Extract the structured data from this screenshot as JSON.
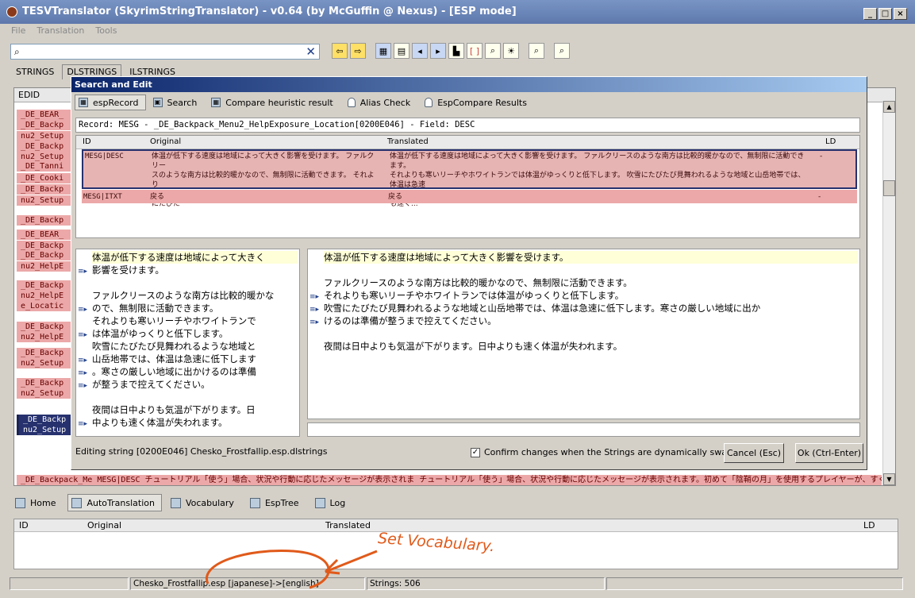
{
  "window": {
    "title": "TESVTranslator (SkyrimStringTranslator) - v0.64 (by McGuffin @ Nexus) - [ESP mode]",
    "buttons": [
      "_",
      "□",
      "×"
    ]
  },
  "menu": [
    "File",
    "Translation",
    "Tools"
  ],
  "search": {
    "value": "",
    "placeholder": ""
  },
  "top_tabs": [
    "STRINGS",
    "DLSTRINGS",
    "ILSTRINGS"
  ],
  "list": {
    "header": "EDID",
    "rows": [
      "_DE_BEAR_",
      "_DE_Backp",
      "nu2_Setup",
      "_DE_Backp",
      "nu2_Setup",
      "_DE_Tanni",
      "_DE_Cooki",
      "_DE_Backp",
      "nu2_Setup",
      "_DE_Backp",
      "_DE_BEAR_",
      "_DE_Backp",
      "_DE_Backp",
      "nu2_HelpE",
      "_DE_Backp",
      "nu2_HelpE",
      "e_Locatic",
      "_DE_Backp",
      "nu2_HelpE",
      "_DE_Backp",
      "nu2_Setup",
      "_DE_Backp",
      "nu2_Setup",
      "_DE_Backp",
      "nu2_Setup"
    ],
    "last_row": "_DE_Backpack_Me    MESG|DESC    チュートリアル「使う」場合、状況や行動に応じたメッセージが表示されま    チュートリアル「使う」場合、状況や行動に応じたメッセージが表示されます。初めて「陰鞘の月」を使用するプレイヤーが、すぐに遊べる"
  },
  "dialog": {
    "title": "Search and Edit",
    "tabs": [
      "espRecord",
      "Search",
      "Compare heuristic result",
      "Alias Check",
      "EspCompare Results"
    ],
    "record": "Record: MESG - _DE_Backpack_Menu2_HelpExposure_Location[0200E046] - Field: DESC",
    "grid": {
      "headers": [
        "ID",
        "Original",
        "Translated",
        "LD"
      ],
      "rows": [
        {
          "id": "MESG|DESC",
          "original": [
            "体温が低下する速度は地域によって大きく影響を受けます。 ファルクリー",
            "スのような南方は比較的暖かなので、無制限に活動できます。 それより",
            "も寒いリーチやホワイトランでは体温がゆっくりと低下します。 吹雪にたびた"
          ],
          "translated": [
            "体温が低下する速度は地域によって大きく影響を受けます。 ファルクリースのような南方は比較的暖かなので、無制限に活動できます。",
            "それよりも寒いリーチやホワイトランでは体温がゆっくりと低下します。 吹雪にたびたび見舞われるような地域と山岳地帯では、体温は急速",
            "に低下します。寒さの厳しい地域に出かけるのは準備が整うまで控えてください。 夜間は日中よりも気温が下がります。日中よりも速く..."
          ],
          "ld": "-"
        },
        {
          "id": "MESG|ITXT",
          "original": [
            "戻る"
          ],
          "translated": [
            "戻る"
          ],
          "ld": "-"
        }
      ]
    },
    "left_lines": [
      "体温が低下する速度は地域によって大きく",
      "影響を受けます。",
      "",
      "ファルクリースのような南方は比較的暖かな",
      "ので、無制限に活動できます。",
      " それよりも寒いリーチやホワイトランで",
      "は体温がゆっくりと低下します。",
      " 吹雪にたびたび見舞われるような地域と",
      "山岳地帯では、体温は急速に低下します",
      "。寒さの厳しい地域に出かけるのは準備",
      "が整うまで控えてください。",
      "",
      "夜間は日中よりも気温が下がります。日",
      "中よりも速く体温が失われます。"
    ],
    "right_lines": [
      "体温が低下する速度は地域によって大きく影響を受けます。",
      "",
      "ファルクリースのような南方は比較的暖かなので、無制限に活動できます。",
      " それよりも寒いリーチやホワイトランでは体温がゆっくりと低下します。",
      " 吹雪にたびたび見舞われるような地域と山岳地帯では、体温は急速に低下します。寒さの厳しい地域に出か",
      "けるのは準備が整うまで控えてください。",
      "",
      "夜間は日中よりも気温が下がります。日中よりも速く体温が失われます。"
    ],
    "status": "Editing string [0200E046] Chesko_Frostfallip.esp.dlstrings",
    "confirm_label": "Confirm changes when the Strings are dynamically swapped",
    "confirm_checked": true,
    "cancel_label": "Cancel  (Esc)",
    "ok_label": "Ok (Ctrl-Enter)"
  },
  "bottom_tabs": [
    "Home",
    "AutoTranslation",
    "Vocabulary",
    "EspTree",
    "Log"
  ],
  "bottom_grid_headers": [
    "ID",
    "Original",
    "Translated",
    "LD"
  ],
  "statusbar": {
    "file": "Chesko_Frostfallip.esp [japanese]->[english]",
    "strings": "Strings: 506"
  },
  "annotation": "Set Vocabulary.",
  "colors": {
    "accent": "#26316e",
    "row_pink": "#eca8a8",
    "annotation": "#e05a1a"
  }
}
